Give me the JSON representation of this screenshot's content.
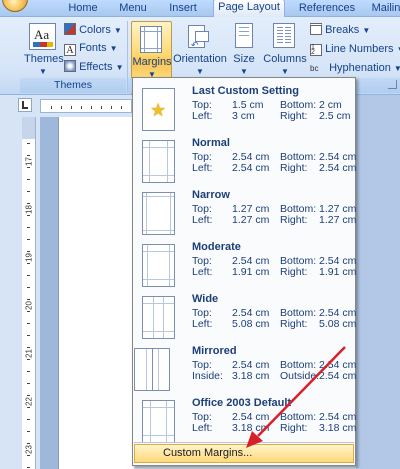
{
  "tabs": [
    {
      "label": "Home"
    },
    {
      "label": "Menu"
    },
    {
      "label": "Insert"
    },
    {
      "label": "Page Layout",
      "active": true
    },
    {
      "label": "References"
    },
    {
      "label": "Mailin"
    }
  ],
  "ribbon": {
    "themes": {
      "label": "Themes",
      "group": "Themes"
    },
    "colors": "Colors",
    "fonts": "Fonts",
    "effects": "Effects",
    "margins": "Margins",
    "orientation": "Orientation",
    "size": "Size",
    "columns": "Columns",
    "breaks": "Breaks",
    "line_numbers": "Line Numbers",
    "hyphenation": "Hyphenation",
    "hyphenation_icon": "bc"
  },
  "ruler": {
    "vertical_numbers": [
      "17",
      "18",
      "19",
      "20",
      "21",
      "22",
      "23",
      "24"
    ]
  },
  "margins_menu": {
    "options": [
      {
        "title": "Last Custom Setting",
        "icon": "star-icon",
        "k1": "Top:",
        "v1": "1.5 cm",
        "k2": "Bottom:",
        "v2": "2 cm",
        "k3": "Left:",
        "v3": "3 cm",
        "k4": "Right:",
        "v4": "2.5 cm"
      },
      {
        "title": "Normal",
        "icon": "page-normal-icon",
        "k1": "Top:",
        "v1": "2.54 cm",
        "k2": "Bottom:",
        "v2": "2.54 cm",
        "k3": "Left:",
        "v3": "2.54 cm",
        "k4": "Right:",
        "v4": "2.54 cm"
      },
      {
        "title": "Narrow",
        "icon": "page-narrow-icon",
        "k1": "Top:",
        "v1": "1.27 cm",
        "k2": "Bottom:",
        "v2": "1.27 cm",
        "k3": "Left:",
        "v3": "1.27 cm",
        "k4": "Right:",
        "v4": "1.27 cm"
      },
      {
        "title": "Moderate",
        "icon": "page-moderate-icon",
        "k1": "Top:",
        "v1": "2.54 cm",
        "k2": "Bottom:",
        "v2": "2.54 cm",
        "k3": "Left:",
        "v3": "1.91 cm",
        "k4": "Right:",
        "v4": "1.91 cm"
      },
      {
        "title": "Wide",
        "icon": "page-wide-icon",
        "k1": "Top:",
        "v1": "2.54 cm",
        "k2": "Bottom:",
        "v2": "2.54 cm",
        "k3": "Left:",
        "v3": "5.08 cm",
        "k4": "Right:",
        "v4": "5.08 cm"
      },
      {
        "title": "Mirrored",
        "icon": "page-mirrored-icon",
        "k1": "Top:",
        "v1": "2.54 cm",
        "k2": "Bottom:",
        "v2": "2.54 cm",
        "k3": "Inside:",
        "v3": "3.18 cm",
        "k4": "Outside:",
        "v4": "2.54 cm"
      },
      {
        "title": "Office 2003 Default",
        "icon": "page-office2003-icon",
        "k1": "Top:",
        "v1": "2.54 cm",
        "k2": "Bottom:",
        "v2": "2.54 cm",
        "k3": "Left:",
        "v3": "3.18 cm",
        "k4": "Right:",
        "v4": "3.18 cm"
      }
    ],
    "custom_margins": "Custom Margins..."
  },
  "colors": {
    "annotation_arrow": "#d8202a",
    "highlight": "#ffd978"
  }
}
